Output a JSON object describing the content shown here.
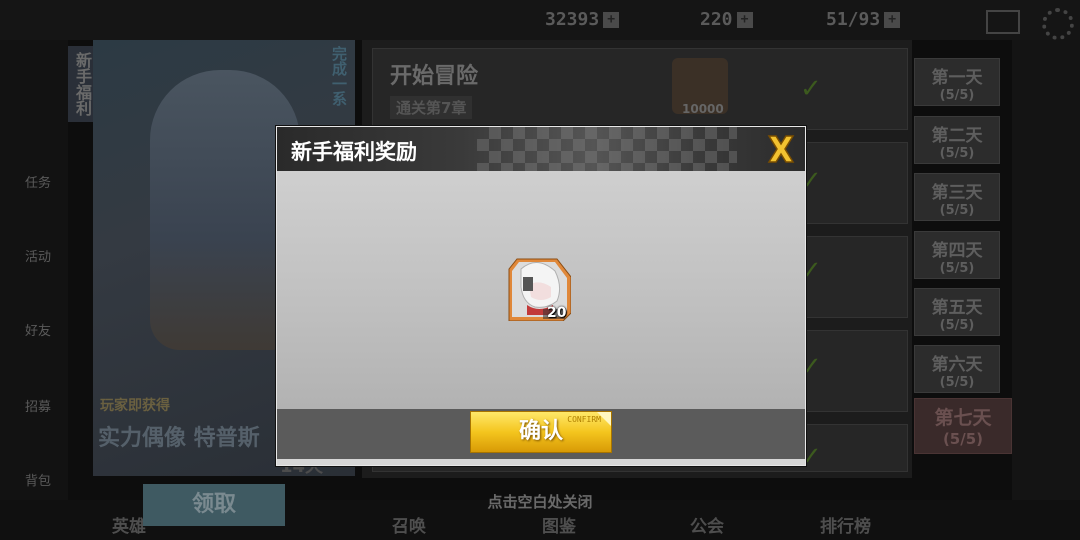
{
  "background": {
    "resources": [
      {
        "name": "gold",
        "value": "32393"
      },
      {
        "name": "diamond",
        "value": "220"
      },
      {
        "name": "stamina",
        "value": "51/93"
      }
    ],
    "left_labels": [
      "任务",
      "活动",
      "好友",
      "招募",
      "背包"
    ],
    "vertical_tab": "新手福利",
    "banner": {
      "done_label": "完成一系",
      "promo_line1": "玩家即获得",
      "promo_line2": "实力偶像 特普斯",
      "days_left": "14天"
    },
    "tasks": [
      {
        "title": "开始冒险",
        "subtitle": "通关第7章",
        "reward_amount": "10000"
      }
    ],
    "days": [
      {
        "label": "第一天",
        "progress": "(5/5)"
      },
      {
        "label": "第二天",
        "progress": "(5/5)"
      },
      {
        "label": "第三天",
        "progress": "(5/5)"
      },
      {
        "label": "第四天",
        "progress": "(5/5)"
      },
      {
        "label": "第五天",
        "progress": "(5/5)"
      },
      {
        "label": "第六天",
        "progress": "(5/5)"
      },
      {
        "label": "第七天",
        "progress": "(5/5)"
      }
    ],
    "claim_button": "领取",
    "bottom_nav": [
      "英雄",
      "召唤",
      "图鉴",
      "公会",
      "排行榜"
    ],
    "close_hint": "点击空白处关闭"
  },
  "modal": {
    "title": "新手福利奖励",
    "reward_item": {
      "count": "20",
      "type": "hero-shard"
    },
    "confirm_label": "确认",
    "confirm_tag": "CONFIRM"
  },
  "colors": {
    "confirm_gold": "#f4c51e",
    "close_x_gold": "#f2c230",
    "header_dark": "#2a2a2a"
  }
}
